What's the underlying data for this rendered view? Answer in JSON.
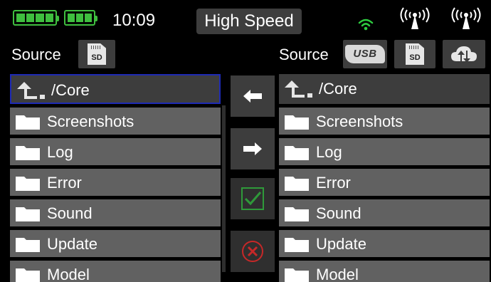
{
  "status": {
    "time": "10:09",
    "mode": "High Speed",
    "battery_1_cells": 4,
    "battery_2_cells": 3,
    "accent_color": "#3fbf3f"
  },
  "left": {
    "source_label": "Source",
    "source_buttons": [
      {
        "name": "sd-card-icon",
        "text": "SD"
      }
    ],
    "path": "/Core",
    "folders": [
      "Screenshots",
      "Log",
      "Error",
      "Sound",
      "Update",
      "Model"
    ]
  },
  "right": {
    "source_label": "Source",
    "source_buttons": [
      {
        "name": "usb-icon",
        "text": "USB"
      },
      {
        "name": "sd-card-icon",
        "text": "SD"
      },
      {
        "name": "cloud-icon"
      }
    ],
    "path": "/Core",
    "folders": [
      "Screenshots",
      "Log",
      "Error",
      "Sound",
      "Update",
      "Model"
    ]
  },
  "actions": {
    "copy_left_icon": "arrow-left-icon",
    "copy_right_icon": "arrow-right-icon",
    "confirm_icon": "checkmark-icon",
    "cancel_icon": "cancel-icon"
  }
}
